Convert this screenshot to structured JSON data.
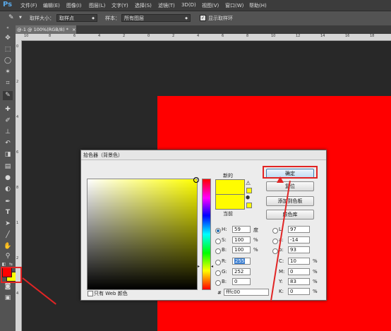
{
  "menubar": {
    "logo": "Ps",
    "items": [
      "文件(F)",
      "编辑(E)",
      "图像(I)",
      "图层(L)",
      "文字(Y)",
      "选择(S)",
      "滤镜(T)",
      "3D(D)",
      "视图(V)",
      "窗口(W)",
      "帮助(H)"
    ]
  },
  "options": {
    "sample_size_label": "取样大小：",
    "sample_size_value": "取样点",
    "sample_label": "样本：",
    "sample_value": "所有图层",
    "show_ring_label": "显示取样环"
  },
  "document": {
    "tab_label": "@-1 @ 100%(RGB/8) *",
    "close": "×"
  },
  "ruler": {
    "h_ticks": [
      "10",
      "8",
      "6",
      "4",
      "2",
      "0",
      "2",
      "4",
      "6",
      "8",
      "10",
      "12",
      "14",
      "16",
      "18"
    ],
    "v_ticks": [
      "0",
      "2",
      "4",
      "6",
      "8",
      "1",
      "2",
      "4"
    ]
  },
  "dialog": {
    "title": "拾色器（背景色）",
    "new_label": "新的",
    "current_label": "当前",
    "ok_label": "确定",
    "reset_label": "复位",
    "add_swatch_label": "添加到色板",
    "color_lib_label": "颜色库",
    "web_only_label": "只有 Web 颜色",
    "hex_label": "#",
    "hex_value": "fffc00",
    "new_color": "#fffc00",
    "current_color": "#fffc00",
    "fields_left": [
      {
        "label": "H:",
        "value": "59",
        "unit": "度",
        "checked": true
      },
      {
        "label": "S:",
        "value": "100",
        "unit": "%",
        "checked": false
      },
      {
        "label": "B:",
        "value": "100",
        "unit": "%",
        "checked": false
      },
      {
        "label": "R:",
        "value": "255",
        "unit": "",
        "checked": false
      },
      {
        "label": "G:",
        "value": "252",
        "unit": "",
        "checked": false
      },
      {
        "label": "B:",
        "value": "0",
        "unit": "",
        "checked": false
      }
    ],
    "fields_right": [
      {
        "label": "L:",
        "value": "97",
        "unit": ""
      },
      {
        "label": "a:",
        "value": "-14",
        "unit": ""
      },
      {
        "label": "b:",
        "value": "93",
        "unit": ""
      },
      {
        "label": "C:",
        "value": "10",
        "unit": "%"
      },
      {
        "label": "M:",
        "value": "0",
        "unit": "%"
      },
      {
        "label": "Y:",
        "value": "83",
        "unit": "%"
      },
      {
        "label": "K:",
        "value": "0",
        "unit": "%"
      }
    ]
  },
  "colors": {
    "foreground": "#ff0000",
    "background": "#fffc00",
    "canvas_fill": "#ff0000",
    "annotation": "#e12424"
  }
}
